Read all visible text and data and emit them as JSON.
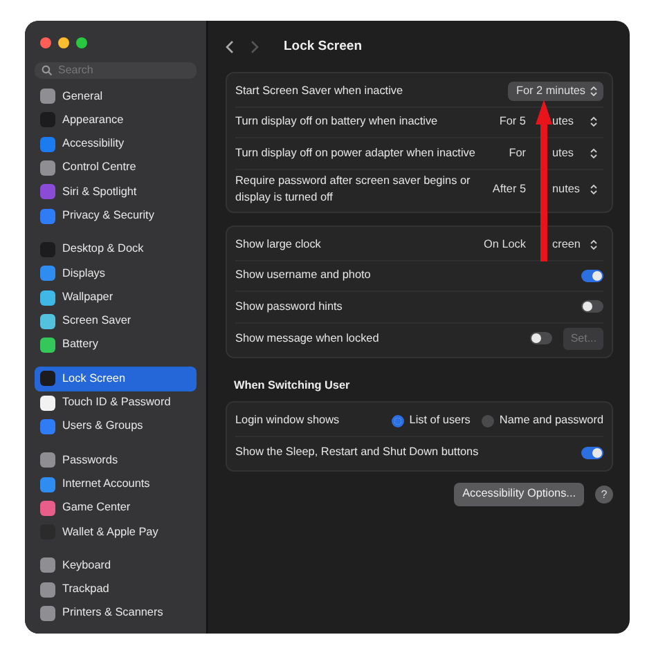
{
  "sidebar": {
    "search": {
      "placeholder": "Search"
    },
    "groups": [
      [
        {
          "label": "General",
          "color": "#8e8e93",
          "selected": false
        },
        {
          "label": "Appearance",
          "color": "#1c1c1e",
          "selected": false
        },
        {
          "label": "Accessibility",
          "color": "#1a7cf0",
          "selected": false
        },
        {
          "label": "Control Centre",
          "color": "#8e8e93",
          "selected": false
        },
        {
          "label": "Siri & Spotlight",
          "color": "#8a4bd6",
          "selected": false
        },
        {
          "label": "Privacy & Security",
          "color": "#2f7cf6",
          "selected": false
        }
      ],
      [
        {
          "label": "Desktop & Dock",
          "color": "#1c1c1e",
          "selected": false
        },
        {
          "label": "Displays",
          "color": "#2f8cf0",
          "selected": false
        },
        {
          "label": "Wallpaper",
          "color": "#3fb8e8",
          "selected": false
        },
        {
          "label": "Screen Saver",
          "color": "#52c2de",
          "selected": false
        },
        {
          "label": "Battery",
          "color": "#34c759",
          "selected": false
        }
      ],
      [
        {
          "label": "Lock Screen",
          "color": "#1c1c1e",
          "selected": true
        },
        {
          "label": "Touch ID & Password",
          "color": "#f2f2f2",
          "selected": false
        },
        {
          "label": "Users & Groups",
          "color": "#2f7cf6",
          "selected": false
        }
      ],
      [
        {
          "label": "Passwords",
          "color": "#8e8e93",
          "selected": false
        },
        {
          "label": "Internet Accounts",
          "color": "#2f8cf0",
          "selected": false
        },
        {
          "label": "Game Center",
          "color": "#e85d8a",
          "selected": false
        },
        {
          "label": "Wallet & Apple Pay",
          "color": "#2b2b2b",
          "selected": false
        }
      ],
      [
        {
          "label": "Keyboard",
          "color": "#8e8e93",
          "selected": false
        },
        {
          "label": "Trackpad",
          "color": "#8e8e93",
          "selected": false
        },
        {
          "label": "Printers & Scanners",
          "color": "#8e8e93",
          "selected": false
        }
      ]
    ]
  },
  "title": "Lock Screen",
  "sections": [
    {
      "rows": [
        {
          "kind": "popup",
          "label": "Start Screen Saver when inactive",
          "value": [
            "For 2 minutes"
          ],
          "selected": true
        },
        {
          "kind": "popup",
          "label": "Turn display off on battery when inactive",
          "value": [
            "For 5",
            "utes"
          ],
          "selected": false
        },
        {
          "kind": "popup",
          "label": "Turn display off on power adapter when inactive",
          "value": [
            "For",
            "utes"
          ],
          "selected": false
        },
        {
          "kind": "popup",
          "label": "Require password after screen saver begins or display is turned off",
          "value": [
            "After 5",
            "nutes"
          ],
          "selected": false
        }
      ]
    },
    {
      "rows": [
        {
          "kind": "popup",
          "label": "Show large clock",
          "value": [
            "On Lock",
            "creen"
          ],
          "selected": false
        },
        {
          "kind": "toggle",
          "label": "Show username and photo",
          "on": true
        },
        {
          "kind": "toggle",
          "label": "Show password hints",
          "on": false
        },
        {
          "kind": "toggle",
          "label": "Show message when locked",
          "on": false,
          "button": "Set...",
          "disabled": true
        }
      ]
    },
    {
      "heading": "When Switching User",
      "rows": [
        {
          "kind": "radio",
          "label": "Login window shows",
          "options": [
            {
              "label": "List of users",
              "selected": true
            },
            {
              "label": "Name and password",
              "selected": false
            }
          ]
        },
        {
          "kind": "toggle",
          "label": "Show the Sleep, Restart and Shut Down buttons",
          "on": true
        }
      ]
    }
  ],
  "footer": {
    "button": "Accessibility Options...",
    "help": "?"
  }
}
